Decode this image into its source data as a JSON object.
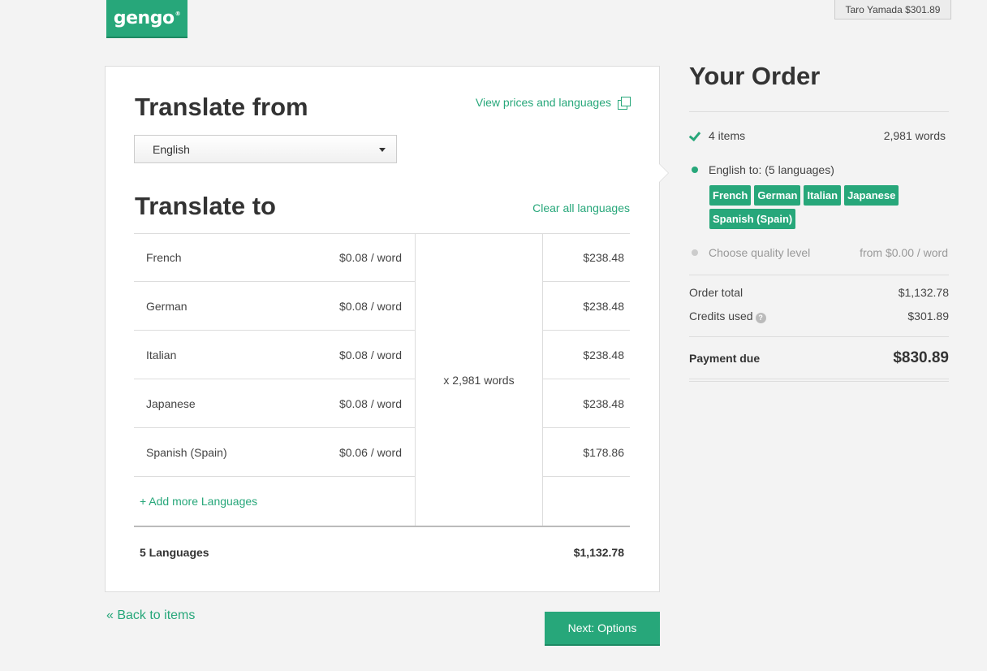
{
  "header": {
    "logo_text": "gengo",
    "logo_mark": "®",
    "user_badge": "Taro Yamada $301.89"
  },
  "translate_from": {
    "heading": "Translate from",
    "view_prices_link": "View prices and languages",
    "selected_language": "English"
  },
  "translate_to": {
    "heading": "Translate to",
    "clear_all_link": "Clear all languages",
    "languages": [
      {
        "name": "French",
        "rate": "$0.08 / word",
        "total": "$238.48"
      },
      {
        "name": "German",
        "rate": "$0.08 / word",
        "total": "$238.48"
      },
      {
        "name": "Italian",
        "rate": "$0.08 / word",
        "total": "$238.48"
      },
      {
        "name": "Japanese",
        "rate": "$0.08 / word",
        "total": "$238.48"
      },
      {
        "name": "Spanish (Spain)",
        "rate": "$0.06 / word",
        "total": "$178.86"
      }
    ],
    "word_multiplier": "x 2,981 words",
    "add_more_link": "+ Add more Languages",
    "total_label": "5 Languages",
    "total_amount": "$1,132.78"
  },
  "footer": {
    "back_link": "« Back to items",
    "next_button": "Next: Options"
  },
  "order": {
    "title": "Your Order",
    "items_label": "4 items",
    "items_words": "2,981 words",
    "target_label": "English to: (5 languages)",
    "tags": [
      "French",
      "German",
      "Italian",
      "Japanese",
      "Spanish (Spain)"
    ],
    "quality_label": "Choose quality level",
    "quality_price": "from $0.00 / word",
    "order_total_label": "Order total",
    "order_total_value": "$1,132.78",
    "credits_label": "Credits used",
    "credits_value": "$301.89",
    "help_glyph": "?",
    "payment_due_label": "Payment due",
    "payment_due_value": "$830.89"
  },
  "colors": {
    "accent": "#27a77a",
    "background": "#f3f3f3"
  }
}
